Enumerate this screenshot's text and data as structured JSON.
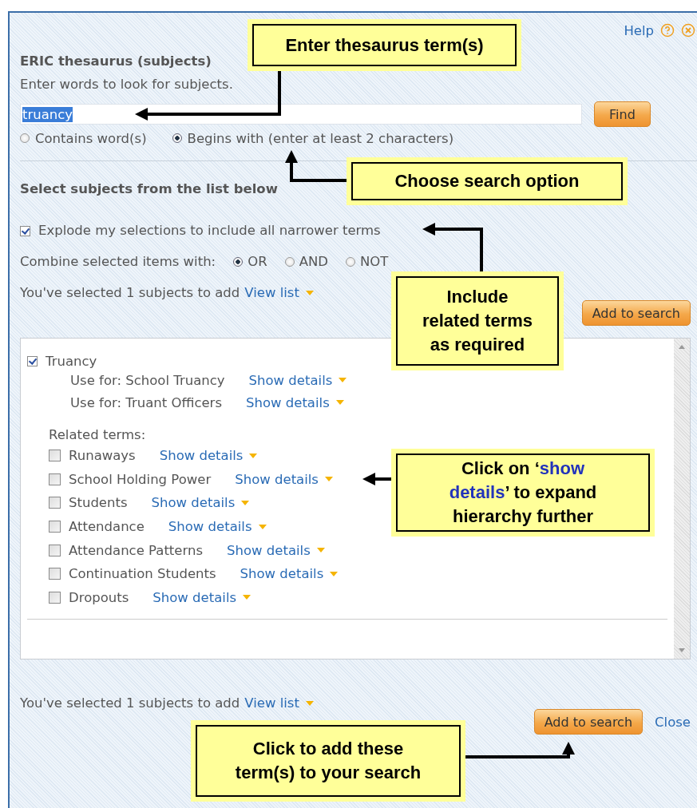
{
  "header": {
    "help": "Help"
  },
  "title": "ERIC thesaurus (subjects)",
  "instruction": "Enter words to look for subjects.",
  "search": {
    "value": "truancy",
    "text_selected": true,
    "button": "Find"
  },
  "match_options": [
    {
      "label": "Contains word(s)",
      "selected": false
    },
    {
      "label": "Begins with (enter at least 2 characters)",
      "selected": true
    }
  ],
  "section_heading": "Select subjects from the list below",
  "explode": {
    "label": "Explode my selections to include all narrower terms",
    "checked": true
  },
  "combine": {
    "label": "Combine selected items with:",
    "options": [
      {
        "label": "OR",
        "selected": true
      },
      {
        "label": "AND",
        "selected": false
      },
      {
        "label": "NOT",
        "selected": false
      }
    ]
  },
  "summary": {
    "text": "You've selected 1 subjects to add",
    "link": "View list"
  },
  "add_button": "Add to search",
  "subjects": {
    "term": {
      "label": "Truancy",
      "checked": true
    },
    "use_for": [
      {
        "label": "Use for: School Truancy",
        "link": "Show details"
      },
      {
        "label": "Use for: Truant Officers",
        "link": "Show details"
      }
    ],
    "related_heading": "Related terms:",
    "related": [
      {
        "label": "Runaways",
        "checked": false,
        "link": "Show details"
      },
      {
        "label": "School Holding Power",
        "checked": false,
        "link": "Show details"
      },
      {
        "label": "Students",
        "checked": false,
        "link": "Show details"
      },
      {
        "label": "Attendance",
        "checked": false,
        "link": "Show details"
      },
      {
        "label": "Attendance Patterns",
        "checked": false,
        "link": "Show details"
      },
      {
        "label": "Continuation Students",
        "checked": false,
        "link": "Show details"
      },
      {
        "label": "Dropouts",
        "checked": false,
        "link": "Show details"
      }
    ]
  },
  "footer": {
    "summary": {
      "text": "You've selected 1 subjects to add",
      "link": "View list"
    },
    "add_button": "Add to search",
    "close": "Close"
  },
  "callouts": [
    {
      "parts": [
        {
          "text": "Enter thesaurus term(s)",
          "highlight": false
        }
      ]
    },
    {
      "parts": [
        {
          "text": "Choose search option",
          "highlight": false
        }
      ]
    },
    {
      "parts": [
        {
          "text": "Include related terms as required",
          "highlight": false
        }
      ]
    },
    {
      "parts": [
        {
          "text": "Click on ‘",
          "highlight": false
        },
        {
          "text": "show details",
          "highlight": true
        },
        {
          "text": "’ to expand hierarchy further",
          "highlight": false
        }
      ]
    },
    {
      "parts": [
        {
          "text": "Click to add these term(s) to your search",
          "highlight": false
        }
      ]
    }
  ]
}
